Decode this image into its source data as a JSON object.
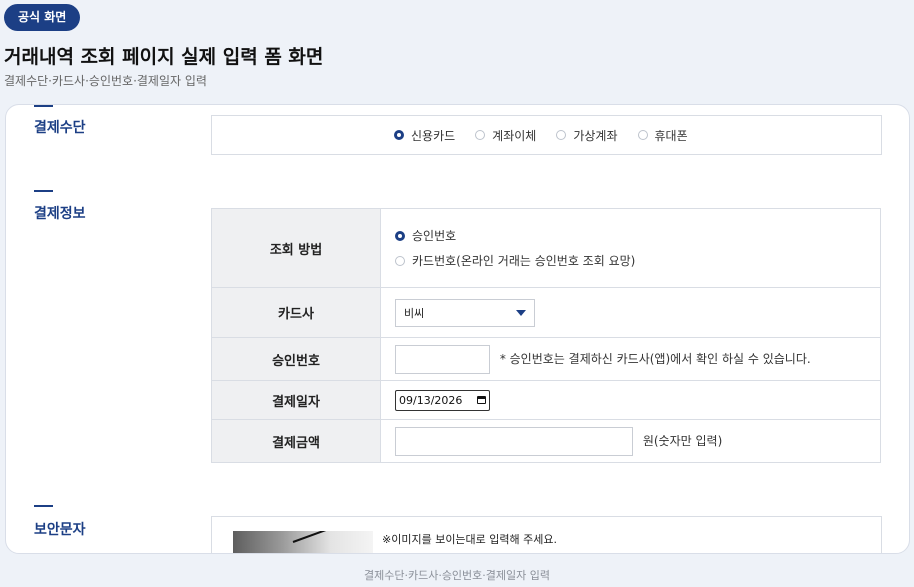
{
  "badge": "공식 화면",
  "title": "거래내역 조회 페이지 실제 입력 폼 화면",
  "subtitle": "결제수단·카드사·승인번호·결제일자 입력",
  "sections": {
    "payment_method": "결제수단",
    "payment_info": "결제정보",
    "security": "보안문자"
  },
  "payment_options": [
    {
      "label": "신용카드",
      "selected": true
    },
    {
      "label": "계좌이체",
      "selected": false
    },
    {
      "label": "가상계좌",
      "selected": false
    },
    {
      "label": "휴대폰",
      "selected": false
    }
  ],
  "form": {
    "method_label": "조회 방법",
    "method_options": [
      {
        "label": "승인번호",
        "selected": true
      },
      {
        "label": "카드번호(온라인 거래는 승인번호 조회 요망)",
        "selected": false
      }
    ],
    "card_company_label": "카드사",
    "card_company_value": "비씨",
    "approval_label": "승인번호",
    "approval_value": "",
    "approval_note": "* 승인번호는 결제하신 카드사(앱)에서 확인 하실 수 있습니다.",
    "date_label": "결제일자",
    "date_value": "09/13/2026",
    "amount_label": "결제금액",
    "amount_value": "",
    "amount_note": "원(숫자만 입력)"
  },
  "security": {
    "note": "※이미지를 보이는대로 입력해 주세요."
  },
  "footer": "결제수단·카드사·승인번호·결제일자 입력",
  "colors": {
    "accent": "#1c3f85",
    "background": "#eef2f8",
    "header_cell": "#eff0f2"
  }
}
